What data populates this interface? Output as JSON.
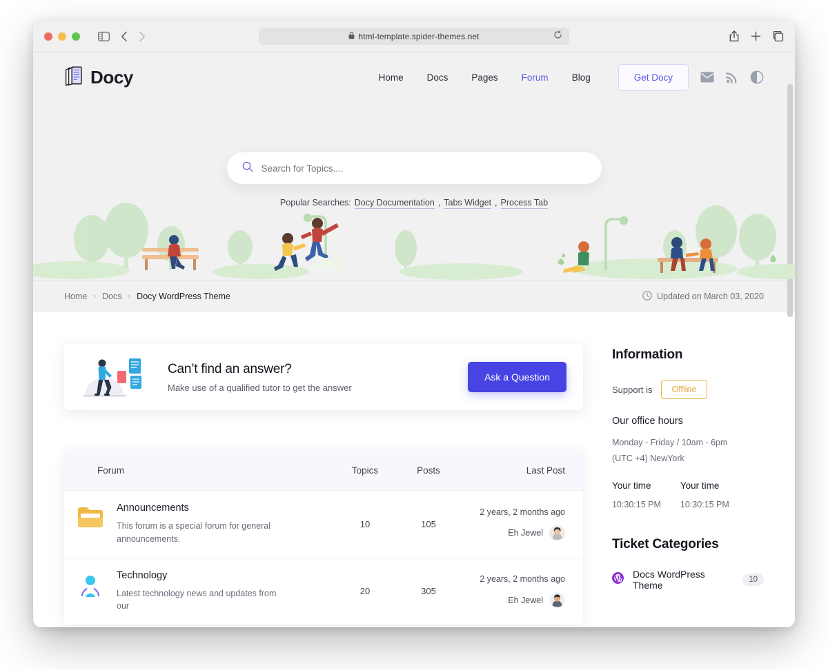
{
  "browser": {
    "url": "html-template.spider-themes.net",
    "lock_icon": "lock-icon",
    "reload_icon": "reload-icon",
    "shield_icon": "privacy-shield-icon",
    "sidebar_icon": "sidebar-toggle-icon",
    "back_icon": "back-chevron-icon",
    "forward_icon": "forward-chevron-icon",
    "share_icon": "share-icon",
    "newtab_icon": "new-tab-icon",
    "tabs_icon": "tab-overview-icon"
  },
  "header": {
    "brand": "Docy",
    "logo_icon": "docs-stack-icon",
    "nav": [
      {
        "label": "Home",
        "active": false
      },
      {
        "label": "Docs",
        "active": false
      },
      {
        "label": "Pages",
        "active": false
      },
      {
        "label": "Forum",
        "active": true
      },
      {
        "label": "Blog",
        "active": false
      }
    ],
    "cta_label": "Get Docy",
    "icons": [
      "mail-icon",
      "rss-icon",
      "contrast-toggle-icon"
    ]
  },
  "hero": {
    "search_placeholder": "Search for Topics....",
    "search_value": "",
    "search_icon": "search-icon",
    "popular_label": "Popular Searches:",
    "popular_links": [
      "Docy Documentation",
      "Tabs Widget",
      "Process Tab"
    ]
  },
  "breadcrumb": {
    "items": [
      "Home",
      "Docs",
      "Docy WordPress Theme"
    ],
    "separator": "›",
    "clock_icon": "clock-icon",
    "updated": "Updated on March 03, 2020"
  },
  "cta": {
    "title": "Can’t find an answer?",
    "subtitle": "Make use of a qualified tutor to get the answer",
    "button": "Ask a Question",
    "illustration": "person-walking-illustration"
  },
  "forum_table": {
    "columns": [
      "Forum",
      "Topics",
      "Posts",
      "Last Post"
    ],
    "rows": [
      {
        "icon": "folder-icon",
        "name": "Announcements",
        "description": "This forum is a special forum for general announcements.",
        "topics": "10",
        "posts": "105",
        "last_post_time": "2 years, 2 months ago",
        "last_post_author": "Eh Jewel"
      },
      {
        "icon": "technology-icon",
        "name": "Technology",
        "description": "Latest technology news and updates from our",
        "topics": "20",
        "posts": "305",
        "last_post_time": "2 years, 2 months ago",
        "last_post_author": "Eh Jewel"
      }
    ]
  },
  "sidebar": {
    "information_title": "Information",
    "support_label": "Support is",
    "support_status": "Offline",
    "office_hours_title": "Our office hours",
    "office_hours": "Monday - Friday / 10am - 6pm (UTC +4) NewYork",
    "time_left_label": "Your time",
    "time_left_value": "10:30:15 PM",
    "time_right_label": "Your time",
    "time_right_value": "10:30:15 PM",
    "ticket_title": "Ticket Categories",
    "categories": [
      {
        "icon": "wordpress-icon",
        "name": "Docs WordPress Theme",
        "count": "10"
      }
    ]
  },
  "colors": {
    "accent": "#4844e3",
    "nav_active": "#5a5aec",
    "warning": "#e0a93b",
    "hero_bg": "#f1f1f1"
  }
}
